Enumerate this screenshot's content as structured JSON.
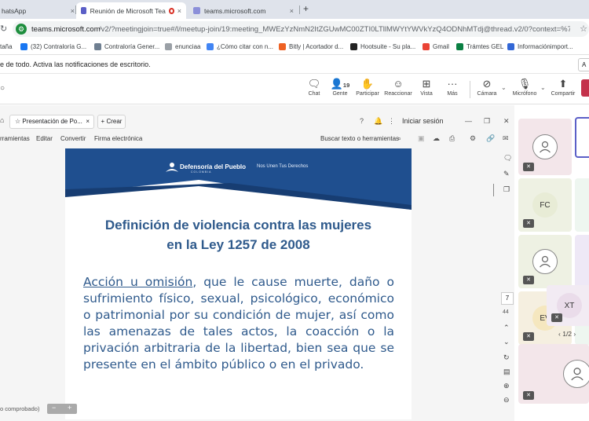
{
  "browser": {
    "tabs": [
      {
        "title": "hatsApp",
        "close": "×"
      },
      {
        "title": "Reunión de Microsoft Tea",
        "close": "×"
      },
      {
        "title": "teams.microsoft.com",
        "close": "×"
      }
    ],
    "new_tab": "+",
    "url_host": "teams.microsoft.com",
    "url_rest": "/v2/?meetingjoin=true#/l/meetup-join/19:meeting_MWEzYzNmN2ItZGUwMC00ZTI0LTllMWYtYWVkYzQ4ODNhMTdj@thread.v2/0?context=%7b\"Tid...",
    "bookmarks": [
      {
        "label": "taña",
        "color": "#f4b400"
      },
      {
        "label": "(32) Contraloría G...",
        "color": "#1877f2"
      },
      {
        "label": "Contraloría Gener...",
        "color": "#6f7f91"
      },
      {
        "label": "enunciaa",
        "color": "#9aa0a6"
      },
      {
        "label": "¿Cómo citar con n...",
        "color": "#4285f4"
      },
      {
        "label": "Bitly | Acortador d...",
        "color": "#ee6123"
      },
      {
        "label": "Hootsuite - Su pla...",
        "color": "#222222"
      },
      {
        "label": "Gmail",
        "color": "#ea4335"
      },
      {
        "label": "Trámtes GEL",
        "color": "#0b8043"
      },
      {
        "label": "Informaciónimport...",
        "color": "#3367d6"
      }
    ]
  },
  "notification": {
    "text": "e de todo. Activa las notificaciones de escritorio.",
    "button": "A"
  },
  "meeting_toolbar": {
    "chat": "Chat",
    "people": "Gente",
    "people_count": "19",
    "participate": "Participar",
    "react": "Reaccionar",
    "view": "Vista",
    "more": "Más",
    "camera": "Cámara",
    "mic": "Micrófono",
    "share": "Compartir",
    "end_color": "#c4314b"
  },
  "presentation": {
    "tab_label": "Presentación de Po...",
    "tab_close": "×",
    "new_button": "+ Crear",
    "sign_in": "Iniciar sesión",
    "menu": [
      "rramientas",
      "Editar",
      "Convertir",
      "Firma electrónica"
    ],
    "search_label": "Buscar texto o herramientas",
    "page_current": "7",
    "page_total": "44",
    "status_text": "o comprobado)",
    "zoom_minus": "−",
    "zoom_plus": "+"
  },
  "slide": {
    "org_name": "Defensoría del Pueblo",
    "org_sub": "COLOMBIA",
    "motto": "Nos Unen Tus Derechos",
    "title_line1": "Definición de violencia contra las mujeres",
    "title_line2": "en la Ley 1257 de 2008",
    "body_underlined": "Acción u omisión",
    "body_rest": ", que le cause muerte, daño o sufrimiento físico, sexual, psicológico, económico o patrimonial por su condición de mujer, así como las amenazas de tales actos, la coacción o la privación arbitraria de la libertad, bien sea que se presente en el ámbito público o en el privado.",
    "header_color": "#1f4f8f",
    "text_color": "#2f5a8c"
  },
  "participants": {
    "tile_initials": [
      "FC",
      "EV",
      "XT"
    ],
    "pager": "1/2",
    "pager_prev": "‹",
    "pager_next": "›"
  }
}
